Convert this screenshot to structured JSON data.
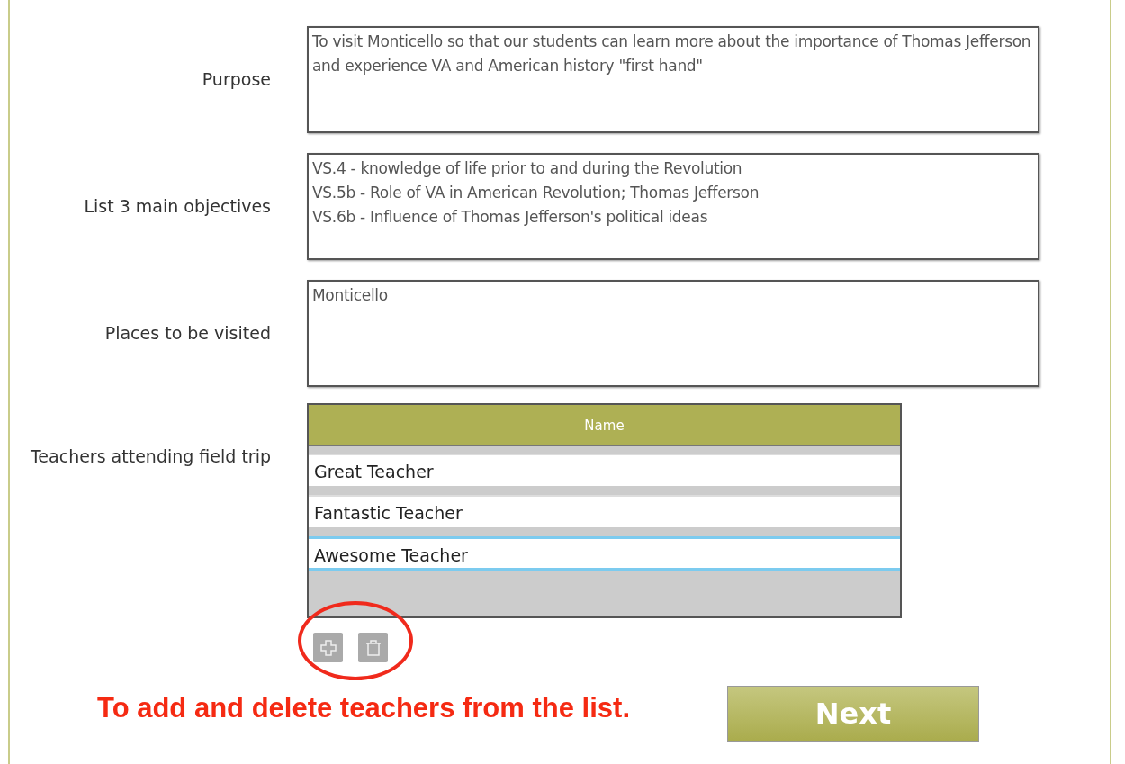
{
  "fields": [
    {
      "label": "Purpose",
      "value": "To visit Monticello so that our students can learn more about the importance of Thomas Jefferson and experience VA and American history \"first hand\""
    },
    {
      "label": "List 3 main objectives",
      "value": "VS.4 - knowledge of life prior to and during the Revolution\nVS.5b - Role of VA in American Revolution; Thomas Jefferson\nVS.6b - Influence of Thomas Jefferson's political ideas"
    },
    {
      "label": "Places to be visited",
      "value": "Monticello"
    }
  ],
  "teachers": {
    "label": "Teachers attending field trip",
    "column": "Name",
    "rows": [
      {
        "name": "Great Teacher",
        "selected": false
      },
      {
        "name": "Fantastic Teacher",
        "selected": false
      },
      {
        "name": "Awesome Teacher",
        "selected": true
      }
    ]
  },
  "annotation": "To add and delete teachers from the list.",
  "next_button": "Next"
}
